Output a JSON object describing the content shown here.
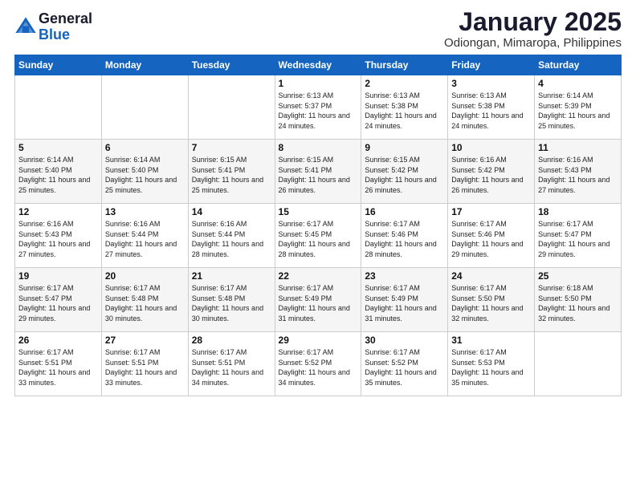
{
  "logo": {
    "general": "General",
    "blue": "Blue"
  },
  "title": "January 2025",
  "location": "Odiongan, Mimaropa, Philippines",
  "weekdays": [
    "Sunday",
    "Monday",
    "Tuesday",
    "Wednesday",
    "Thursday",
    "Friday",
    "Saturday"
  ],
  "weeks": [
    [
      {
        "day": "",
        "sunrise": "",
        "sunset": "",
        "daylight": ""
      },
      {
        "day": "",
        "sunrise": "",
        "sunset": "",
        "daylight": ""
      },
      {
        "day": "",
        "sunrise": "",
        "sunset": "",
        "daylight": ""
      },
      {
        "day": "1",
        "sunrise": "Sunrise: 6:13 AM",
        "sunset": "Sunset: 5:37 PM",
        "daylight": "Daylight: 11 hours and 24 minutes."
      },
      {
        "day": "2",
        "sunrise": "Sunrise: 6:13 AM",
        "sunset": "Sunset: 5:38 PM",
        "daylight": "Daylight: 11 hours and 24 minutes."
      },
      {
        "day": "3",
        "sunrise": "Sunrise: 6:13 AM",
        "sunset": "Sunset: 5:38 PM",
        "daylight": "Daylight: 11 hours and 24 minutes."
      },
      {
        "day": "4",
        "sunrise": "Sunrise: 6:14 AM",
        "sunset": "Sunset: 5:39 PM",
        "daylight": "Daylight: 11 hours and 25 minutes."
      }
    ],
    [
      {
        "day": "5",
        "sunrise": "Sunrise: 6:14 AM",
        "sunset": "Sunset: 5:40 PM",
        "daylight": "Daylight: 11 hours and 25 minutes."
      },
      {
        "day": "6",
        "sunrise": "Sunrise: 6:14 AM",
        "sunset": "Sunset: 5:40 PM",
        "daylight": "Daylight: 11 hours and 25 minutes."
      },
      {
        "day": "7",
        "sunrise": "Sunrise: 6:15 AM",
        "sunset": "Sunset: 5:41 PM",
        "daylight": "Daylight: 11 hours and 25 minutes."
      },
      {
        "day": "8",
        "sunrise": "Sunrise: 6:15 AM",
        "sunset": "Sunset: 5:41 PM",
        "daylight": "Daylight: 11 hours and 26 minutes."
      },
      {
        "day": "9",
        "sunrise": "Sunrise: 6:15 AM",
        "sunset": "Sunset: 5:42 PM",
        "daylight": "Daylight: 11 hours and 26 minutes."
      },
      {
        "day": "10",
        "sunrise": "Sunrise: 6:16 AM",
        "sunset": "Sunset: 5:42 PM",
        "daylight": "Daylight: 11 hours and 26 minutes."
      },
      {
        "day": "11",
        "sunrise": "Sunrise: 6:16 AM",
        "sunset": "Sunset: 5:43 PM",
        "daylight": "Daylight: 11 hours and 27 minutes."
      }
    ],
    [
      {
        "day": "12",
        "sunrise": "Sunrise: 6:16 AM",
        "sunset": "Sunset: 5:43 PM",
        "daylight": "Daylight: 11 hours and 27 minutes."
      },
      {
        "day": "13",
        "sunrise": "Sunrise: 6:16 AM",
        "sunset": "Sunset: 5:44 PM",
        "daylight": "Daylight: 11 hours and 27 minutes."
      },
      {
        "day": "14",
        "sunrise": "Sunrise: 6:16 AM",
        "sunset": "Sunset: 5:44 PM",
        "daylight": "Daylight: 11 hours and 28 minutes."
      },
      {
        "day": "15",
        "sunrise": "Sunrise: 6:17 AM",
        "sunset": "Sunset: 5:45 PM",
        "daylight": "Daylight: 11 hours and 28 minutes."
      },
      {
        "day": "16",
        "sunrise": "Sunrise: 6:17 AM",
        "sunset": "Sunset: 5:46 PM",
        "daylight": "Daylight: 11 hours and 28 minutes."
      },
      {
        "day": "17",
        "sunrise": "Sunrise: 6:17 AM",
        "sunset": "Sunset: 5:46 PM",
        "daylight": "Daylight: 11 hours and 29 minutes."
      },
      {
        "day": "18",
        "sunrise": "Sunrise: 6:17 AM",
        "sunset": "Sunset: 5:47 PM",
        "daylight": "Daylight: 11 hours and 29 minutes."
      }
    ],
    [
      {
        "day": "19",
        "sunrise": "Sunrise: 6:17 AM",
        "sunset": "Sunset: 5:47 PM",
        "daylight": "Daylight: 11 hours and 29 minutes."
      },
      {
        "day": "20",
        "sunrise": "Sunrise: 6:17 AM",
        "sunset": "Sunset: 5:48 PM",
        "daylight": "Daylight: 11 hours and 30 minutes."
      },
      {
        "day": "21",
        "sunrise": "Sunrise: 6:17 AM",
        "sunset": "Sunset: 5:48 PM",
        "daylight": "Daylight: 11 hours and 30 minutes."
      },
      {
        "day": "22",
        "sunrise": "Sunrise: 6:17 AM",
        "sunset": "Sunset: 5:49 PM",
        "daylight": "Daylight: 11 hours and 31 minutes."
      },
      {
        "day": "23",
        "sunrise": "Sunrise: 6:17 AM",
        "sunset": "Sunset: 5:49 PM",
        "daylight": "Daylight: 11 hours and 31 minutes."
      },
      {
        "day": "24",
        "sunrise": "Sunrise: 6:17 AM",
        "sunset": "Sunset: 5:50 PM",
        "daylight": "Daylight: 11 hours and 32 minutes."
      },
      {
        "day": "25",
        "sunrise": "Sunrise: 6:18 AM",
        "sunset": "Sunset: 5:50 PM",
        "daylight": "Daylight: 11 hours and 32 minutes."
      }
    ],
    [
      {
        "day": "26",
        "sunrise": "Sunrise: 6:17 AM",
        "sunset": "Sunset: 5:51 PM",
        "daylight": "Daylight: 11 hours and 33 minutes."
      },
      {
        "day": "27",
        "sunrise": "Sunrise: 6:17 AM",
        "sunset": "Sunset: 5:51 PM",
        "daylight": "Daylight: 11 hours and 33 minutes."
      },
      {
        "day": "28",
        "sunrise": "Sunrise: 6:17 AM",
        "sunset": "Sunset: 5:51 PM",
        "daylight": "Daylight: 11 hours and 34 minutes."
      },
      {
        "day": "29",
        "sunrise": "Sunrise: 6:17 AM",
        "sunset": "Sunset: 5:52 PM",
        "daylight": "Daylight: 11 hours and 34 minutes."
      },
      {
        "day": "30",
        "sunrise": "Sunrise: 6:17 AM",
        "sunset": "Sunset: 5:52 PM",
        "daylight": "Daylight: 11 hours and 35 minutes."
      },
      {
        "day": "31",
        "sunrise": "Sunrise: 6:17 AM",
        "sunset": "Sunset: 5:53 PM",
        "daylight": "Daylight: 11 hours and 35 minutes."
      },
      {
        "day": "",
        "sunrise": "",
        "sunset": "",
        "daylight": ""
      }
    ]
  ]
}
